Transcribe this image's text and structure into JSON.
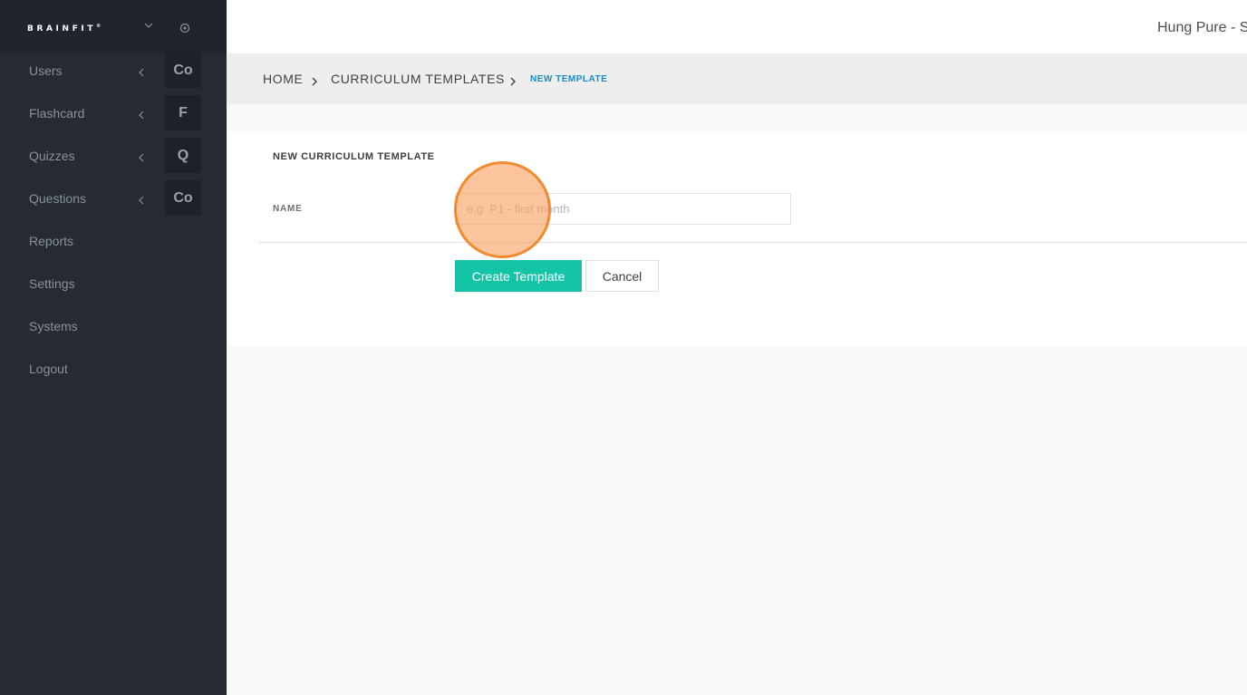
{
  "sidebar": {
    "logo": "BRAINFIT",
    "logo_mark": "®",
    "items": [
      {
        "label": "Users",
        "tile": "Co"
      },
      {
        "label": "Flashcard",
        "tile": "F"
      },
      {
        "label": "Quizzes",
        "tile": "Q"
      },
      {
        "label": "Questions",
        "tile": "Co"
      },
      {
        "label": "Reports"
      },
      {
        "label": "Settings"
      },
      {
        "label": "Systems"
      },
      {
        "label": "Logout"
      }
    ],
    "icons": {
      "dropdown": "chevron-down-icon",
      "settings": "gear-icon",
      "expand": "chevron-left-icon"
    }
  },
  "header": {
    "user": "Hung Pure - S"
  },
  "breadcrumb": {
    "items": [
      "HOME",
      "CURRICULUM TEMPLATES"
    ],
    "current": "NEW TEMPLATE"
  },
  "form": {
    "title": "NEW CURRICULUM TEMPLATE",
    "name_label": "NAME",
    "name_value": "",
    "name_placeholder": "e.g. P1 - first month",
    "create_label": "Create Template",
    "cancel_label": "Cancel"
  },
  "colors": {
    "sidebar_bg": "#252a33",
    "accent": "#13c4a7",
    "breadcrumb_active": "#1a8bc4",
    "click_indicator": "#f28a2e"
  }
}
